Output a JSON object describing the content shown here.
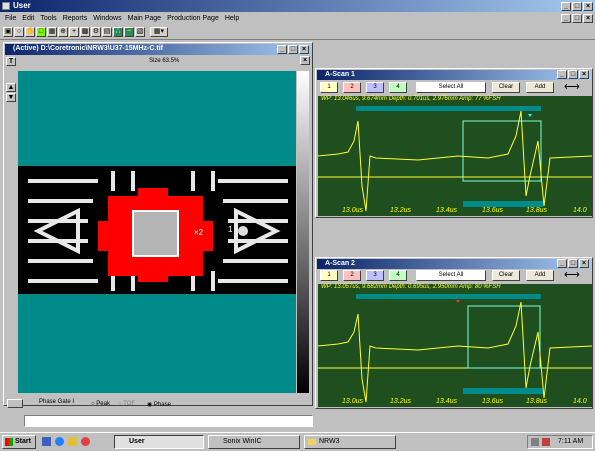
{
  "app": {
    "title": "User"
  },
  "menu": [
    "File",
    "Edit",
    "Tools",
    "Reports",
    "Windows",
    "Main Page",
    "Production Page",
    "Help"
  ],
  "image_window": {
    "title": "(Active) D:\\Coretronic\\NRW3\\U37-15MHz-C.tif",
    "size_label": "Size 63.5%",
    "marker_2": "×2",
    "marker_1": "1",
    "phase_gate": "Phase Gate I",
    "radio_peak": "Peak",
    "radio_tof": "TOF",
    "radio_phase": "Phase",
    "colors": {
      "background": "#008b8b",
      "gate": "#ff0000"
    }
  },
  "ascan1": {
    "title": "A-Scan 1",
    "gate_buttons": [
      "1",
      "2",
      "3",
      "4"
    ],
    "select_all": "Select All",
    "clear": "Clear",
    "add": "Add",
    "info": "WP: 13.046us, 9.674mm  Depth: 0.701us, 2.976mm  Amp:  77 %FSH",
    "axis_ticks": [
      "13.0us",
      "13.2us",
      "13.4us",
      "13.6us",
      "13.8us",
      "14.0"
    ]
  },
  "ascan2": {
    "title": "A-Scan 2",
    "gate_buttons": [
      "1",
      "2",
      "3",
      "4"
    ],
    "select_all": "Select All",
    "clear": "Clear",
    "add": "Add",
    "info": "WP: 13.057us, 9.682mm  Depth: 0.695us, 2.950mm  Amp:  80 %FSH",
    "axis_ticks": [
      "13.0us",
      "13.2us",
      "13.4us",
      "13.6us",
      "13.8us",
      "14.0"
    ]
  },
  "taskbar": {
    "start": "Start",
    "tasks": [
      "User",
      "Sonix WinIC",
      "NRW3"
    ],
    "clock": "7:11 AM"
  },
  "colors": {
    "plot_bg": "#1f4e1f",
    "trace": "#ffff33",
    "gate": "#008b8b",
    "gate_box": "#7fffd4"
  }
}
